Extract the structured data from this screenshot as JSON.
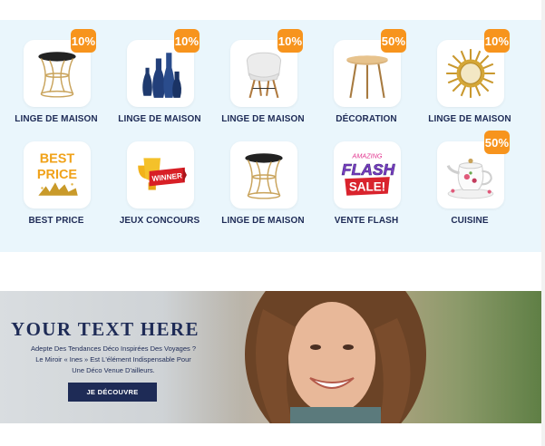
{
  "categories": [
    {
      "label": "LINGE DE MAISON",
      "badge": "10%",
      "icon": "side-table-icon"
    },
    {
      "label": "LINGE DE MAISON",
      "badge": "10%",
      "icon": "vases-icon"
    },
    {
      "label": "LINGE DE MAISON",
      "badge": "10%",
      "icon": "chair-icon"
    },
    {
      "label": "DÉCORATION",
      "badge": "50%",
      "icon": "round-table-icon"
    },
    {
      "label": "LINGE DE MAISON",
      "badge": "10%",
      "icon": "sun-mirror-icon"
    },
    {
      "label": "BEST PRICE",
      "badge": "",
      "icon": "best-price-icon",
      "art_text": [
        "BEST",
        "PRICE"
      ]
    },
    {
      "label": "JEUX CONCOURS",
      "badge": "",
      "icon": "winner-trophy-icon",
      "art_text": [
        "WINNER"
      ]
    },
    {
      "label": "LINGE DE MAISON",
      "badge": "",
      "icon": "side-table-icon"
    },
    {
      "label": "VENTE FLASH",
      "badge": "",
      "icon": "flash-sale-icon",
      "art_text": [
        "AMAZING",
        "FLASH",
        "SALE!"
      ]
    },
    {
      "label": "CUISINE",
      "badge": "50%",
      "icon": "teapot-icon"
    }
  ],
  "hero": {
    "title": "YOUR TEXT HERE",
    "lines": [
      "Adepte Des Tendances Déco Inspirées Des Voyages ?",
      "Le Miroir « Ines » Est L'élément Indispensable Pour",
      "Une Déco Venue D'ailleurs."
    ],
    "button": "JE DÉCOUVRE"
  },
  "colors": {
    "accent": "#f7941d",
    "navy": "#1e2b56",
    "panel": "#eaf6fc"
  }
}
